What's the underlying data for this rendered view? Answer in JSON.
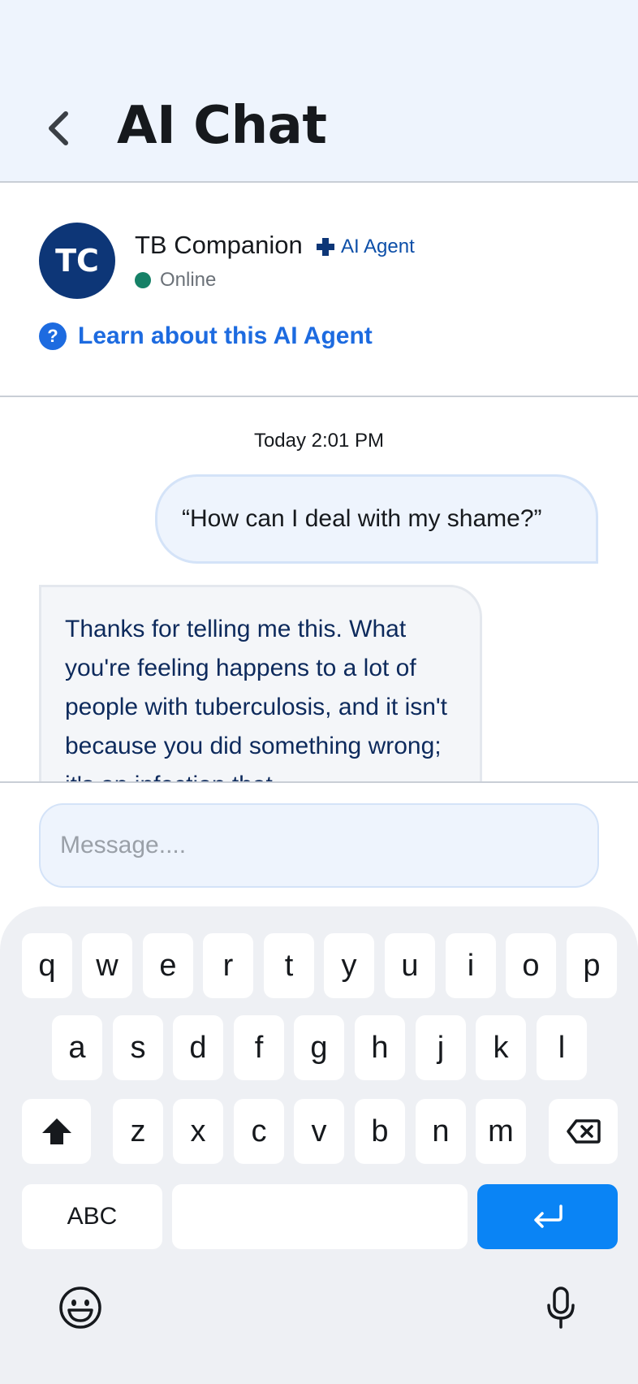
{
  "header": {
    "title": "AI Chat",
    "back_icon": "chevron-left-icon"
  },
  "agent": {
    "avatar_initials": "TC",
    "name": "TB Companion",
    "badge_label": "AI Agent",
    "badge_icon": "plus-cross-icon",
    "status": "Online",
    "learn_link": "Learn about this AI Agent",
    "help_icon": "question-circle-icon"
  },
  "chat": {
    "timestamp": "Today 2:01 PM",
    "messages": [
      {
        "role": "user",
        "text": "“How can I deal with my shame?”"
      },
      {
        "role": "agent",
        "text": "Thanks for telling me this. What you're feeling happens to a lot of people with tuberculosis, and it isn't because you did something wrong; it's an infection that"
      }
    ]
  },
  "composer": {
    "placeholder": "Message....",
    "value": ""
  },
  "keyboard": {
    "row1": [
      "q",
      "w",
      "e",
      "r",
      "t",
      "y",
      "u",
      "i",
      "o",
      "p"
    ],
    "row2": [
      "a",
      "s",
      "d",
      "f",
      "g",
      "h",
      "j",
      "k",
      "l"
    ],
    "row3": [
      "z",
      "x",
      "c",
      "v",
      "b",
      "n",
      "m"
    ],
    "mode_key": "ABC",
    "shift_icon": "shift-arrow-icon",
    "backspace_icon": "backspace-icon",
    "enter_icon": "enter-return-icon",
    "emoji_icon": "emoji-smile-icon",
    "mic_icon": "microphone-icon"
  },
  "colors": {
    "header_bg": "#eef4fd",
    "avatar_bg": "#0d3677",
    "link": "#1d6be0",
    "online": "#168167",
    "enter_key": "#0a84f5"
  }
}
